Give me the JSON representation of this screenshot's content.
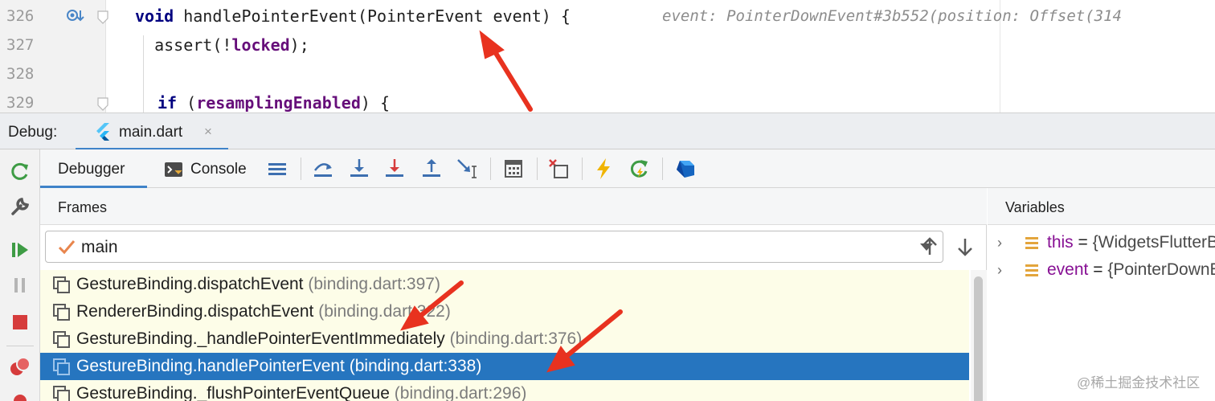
{
  "editor": {
    "lines": [
      {
        "num": "326",
        "kw": "void",
        "rest": " handlePointerEvent(PointerEvent event) {"
      },
      {
        "num": "327",
        "pre": "  assert(!",
        "ident": "locked",
        "post": ");"
      },
      {
        "num": "328"
      },
      {
        "num": "329",
        "kw": "if",
        "rest": " (",
        "ident": "resamplingEnabled",
        "post": ") {"
      }
    ],
    "inline_hint": "event: PointerDownEvent#3b552(position: Offset(314"
  },
  "debug_window": {
    "label": "Debug:",
    "run_tab": "main.dart",
    "close_glyph": "×"
  },
  "tabs": {
    "debugger": "Debugger",
    "console": "Console"
  },
  "frames": {
    "title": "Frames",
    "thread": "main",
    "items": [
      {
        "method": "GestureBinding.dispatchEvent",
        "location": "(binding.dart:397)"
      },
      {
        "method": "RendererBinding.dispatchEvent",
        "location": "(binding.dart:322)"
      },
      {
        "method": "GestureBinding._handlePointerEventImmediately",
        "location": "(binding.dart:376)"
      },
      {
        "method": "GestureBinding.handlePointerEvent",
        "location": "(binding.dart:338)"
      },
      {
        "method": "GestureBinding._flushPointerEventQueue",
        "location": "(binding.dart:296)"
      }
    ],
    "selected_index": 3
  },
  "variables": {
    "title": "Variables",
    "items": [
      {
        "name": "this",
        "eq": " = ",
        "value": "{WidgetsFlutterBinding}"
      },
      {
        "name": "event",
        "eq": " = ",
        "value": "{PointerDownEvent}"
      }
    ]
  },
  "watermark": "@稀土掘金技术社区",
  "colors": {
    "selection": "#2675bf",
    "accent": "#4083c9",
    "annotation_arrow": "#e8321f"
  }
}
